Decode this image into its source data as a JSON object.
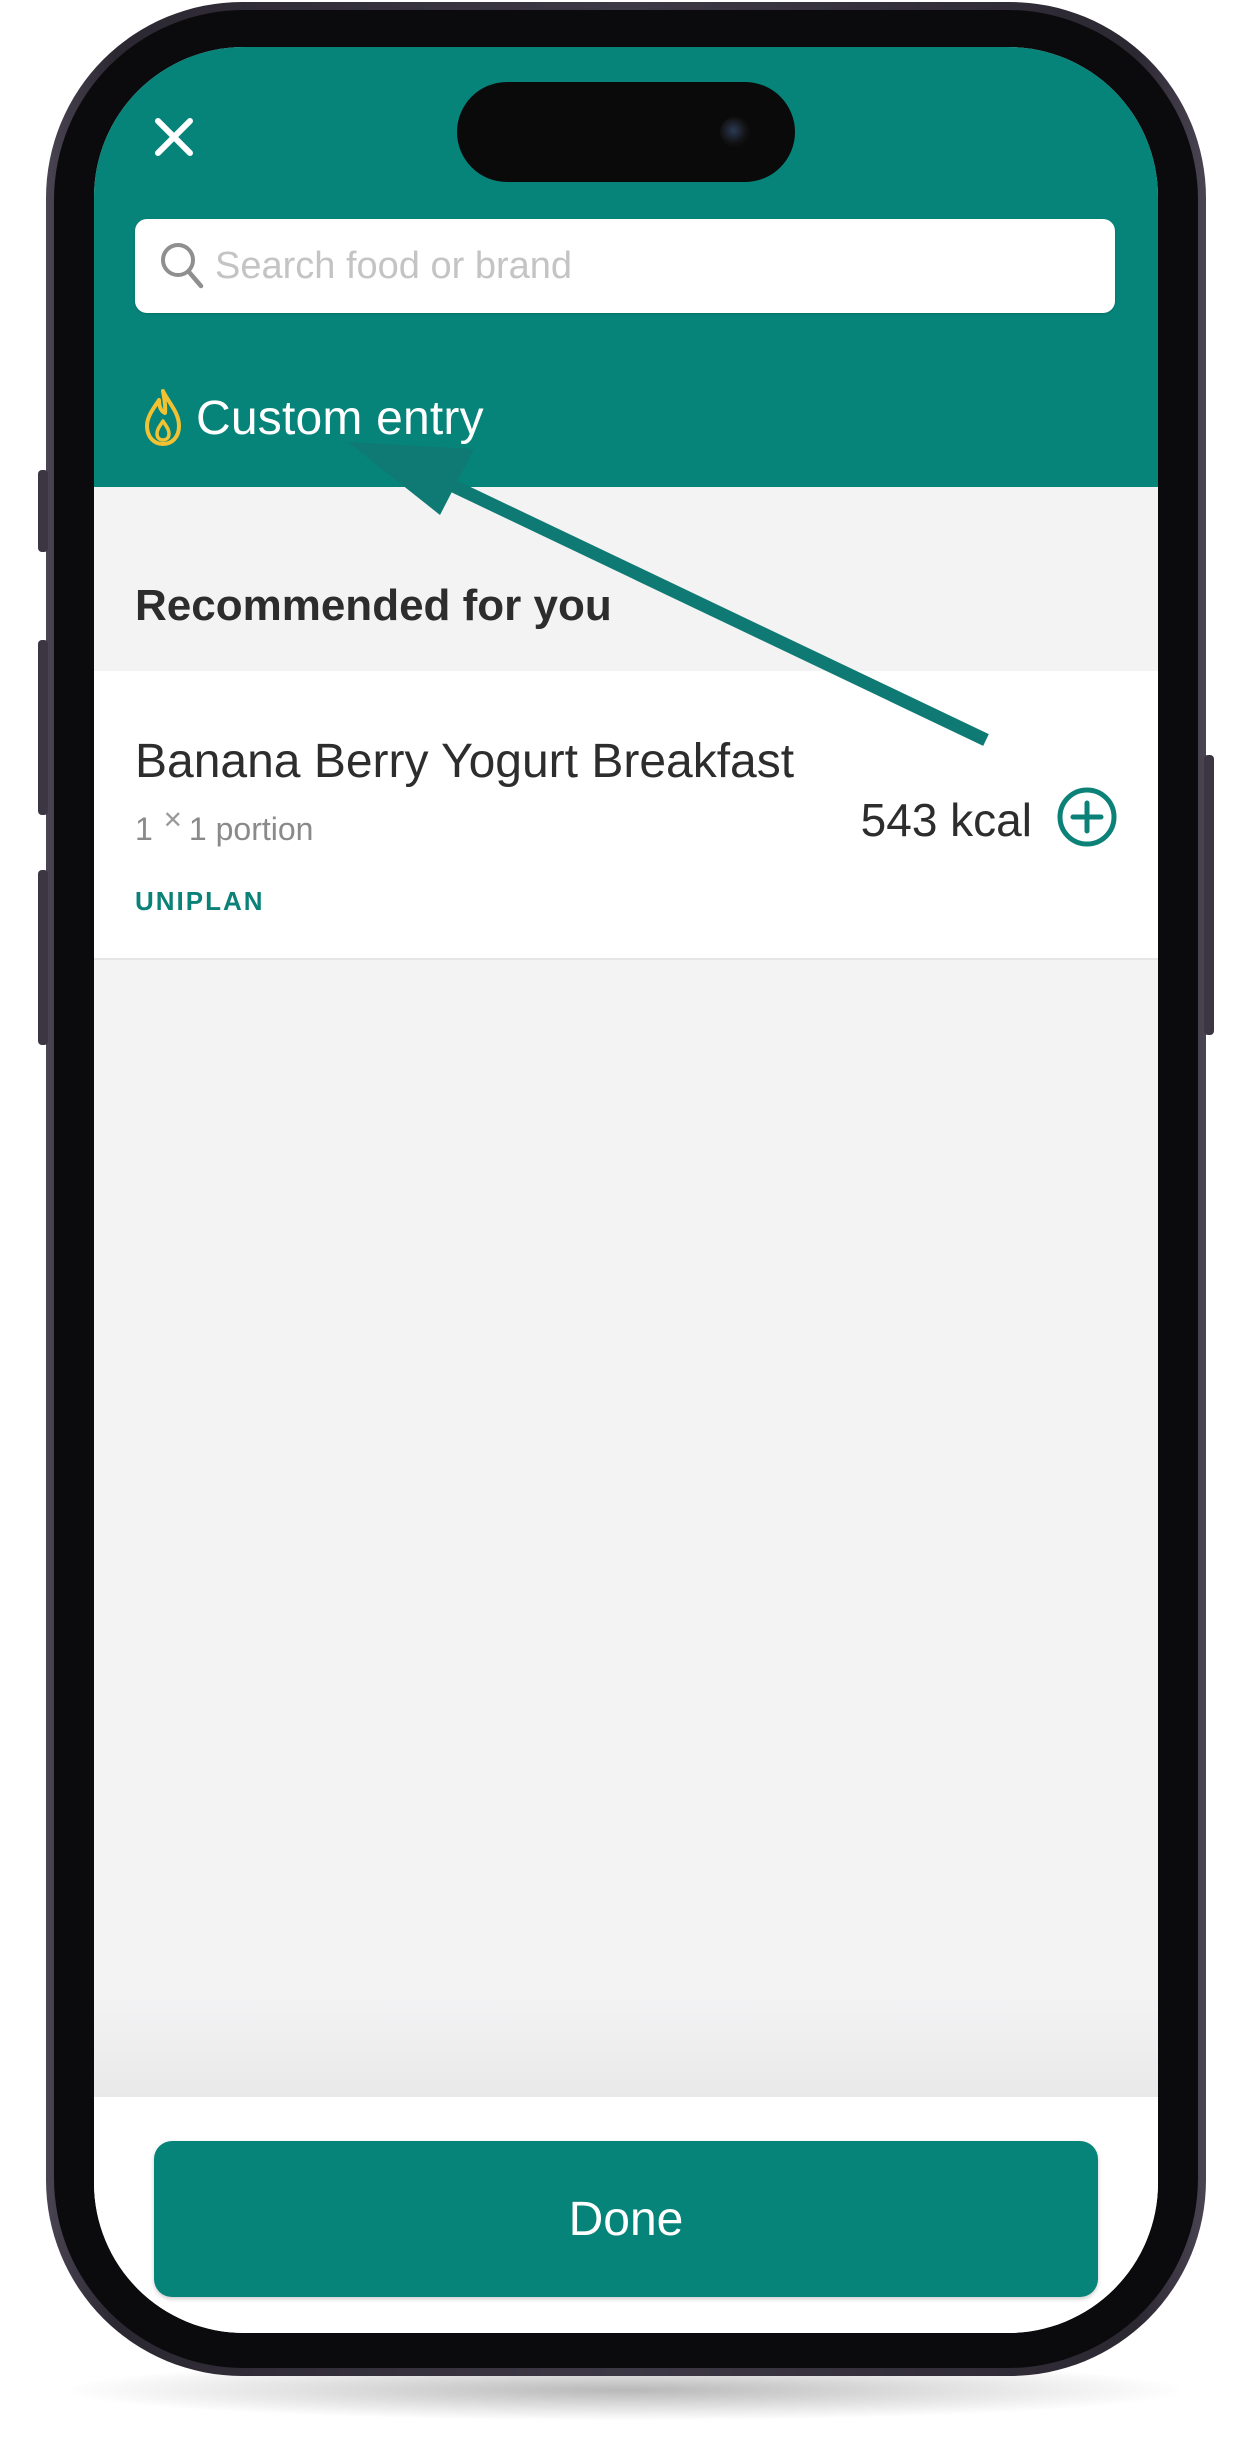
{
  "colors": {
    "brand_teal": "#06847a",
    "flame_yellow": "#f2c233",
    "screen_background": "#f3f3f4"
  },
  "header": {
    "close_icon": "close-icon",
    "search": {
      "placeholder": "Search food or brand",
      "value": "",
      "icon": "search-icon"
    },
    "custom_entry": {
      "label": "Custom entry",
      "icon": "flame-icon"
    }
  },
  "recommendations": {
    "title": "Recommended for you",
    "items": [
      {
        "name": "Banana Berry Yogurt Breakfast",
        "quantity": "1",
        "portion": "1 portion",
        "brand": "UNIPLAN",
        "calories": "543 kcal",
        "add_icon": "plus-circle-icon"
      }
    ]
  },
  "annotation": {
    "type": "arrow",
    "points_to": "custom-entry",
    "color": "#0e7a73"
  },
  "footer": {
    "done_label": "Done"
  }
}
